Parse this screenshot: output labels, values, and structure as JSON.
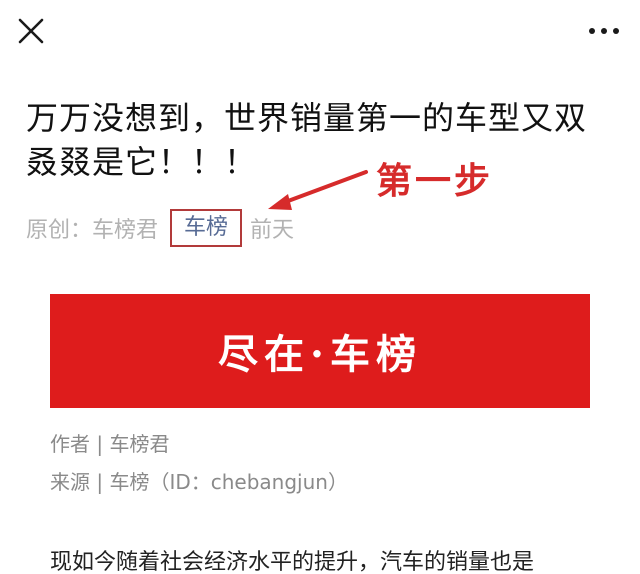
{
  "topbar": {
    "close_icon": "close-icon",
    "more_icon": "more-dots-icon"
  },
  "article": {
    "title": "万万没想到，世界销量第一的车型又双叒叕是它！！！",
    "meta": {
      "prefix": "原创：车榜君",
      "account": "车榜",
      "time": "前天"
    },
    "annotation": {
      "label": "第一步",
      "color": "#d62b2b"
    },
    "banner": {
      "text": "尽在·车榜",
      "color": "#de1c1c"
    },
    "author_line": "作者 | 车榜君",
    "source_line": "来源 | 车榜（ID：chebangjun）",
    "body_first_line": "现如今随着社会经济水平的提升，汽车的销量也是"
  },
  "colors": {
    "link": "#576b95",
    "meta_gray": "#b2b2b2",
    "highlight_border": "#b23a3a"
  }
}
